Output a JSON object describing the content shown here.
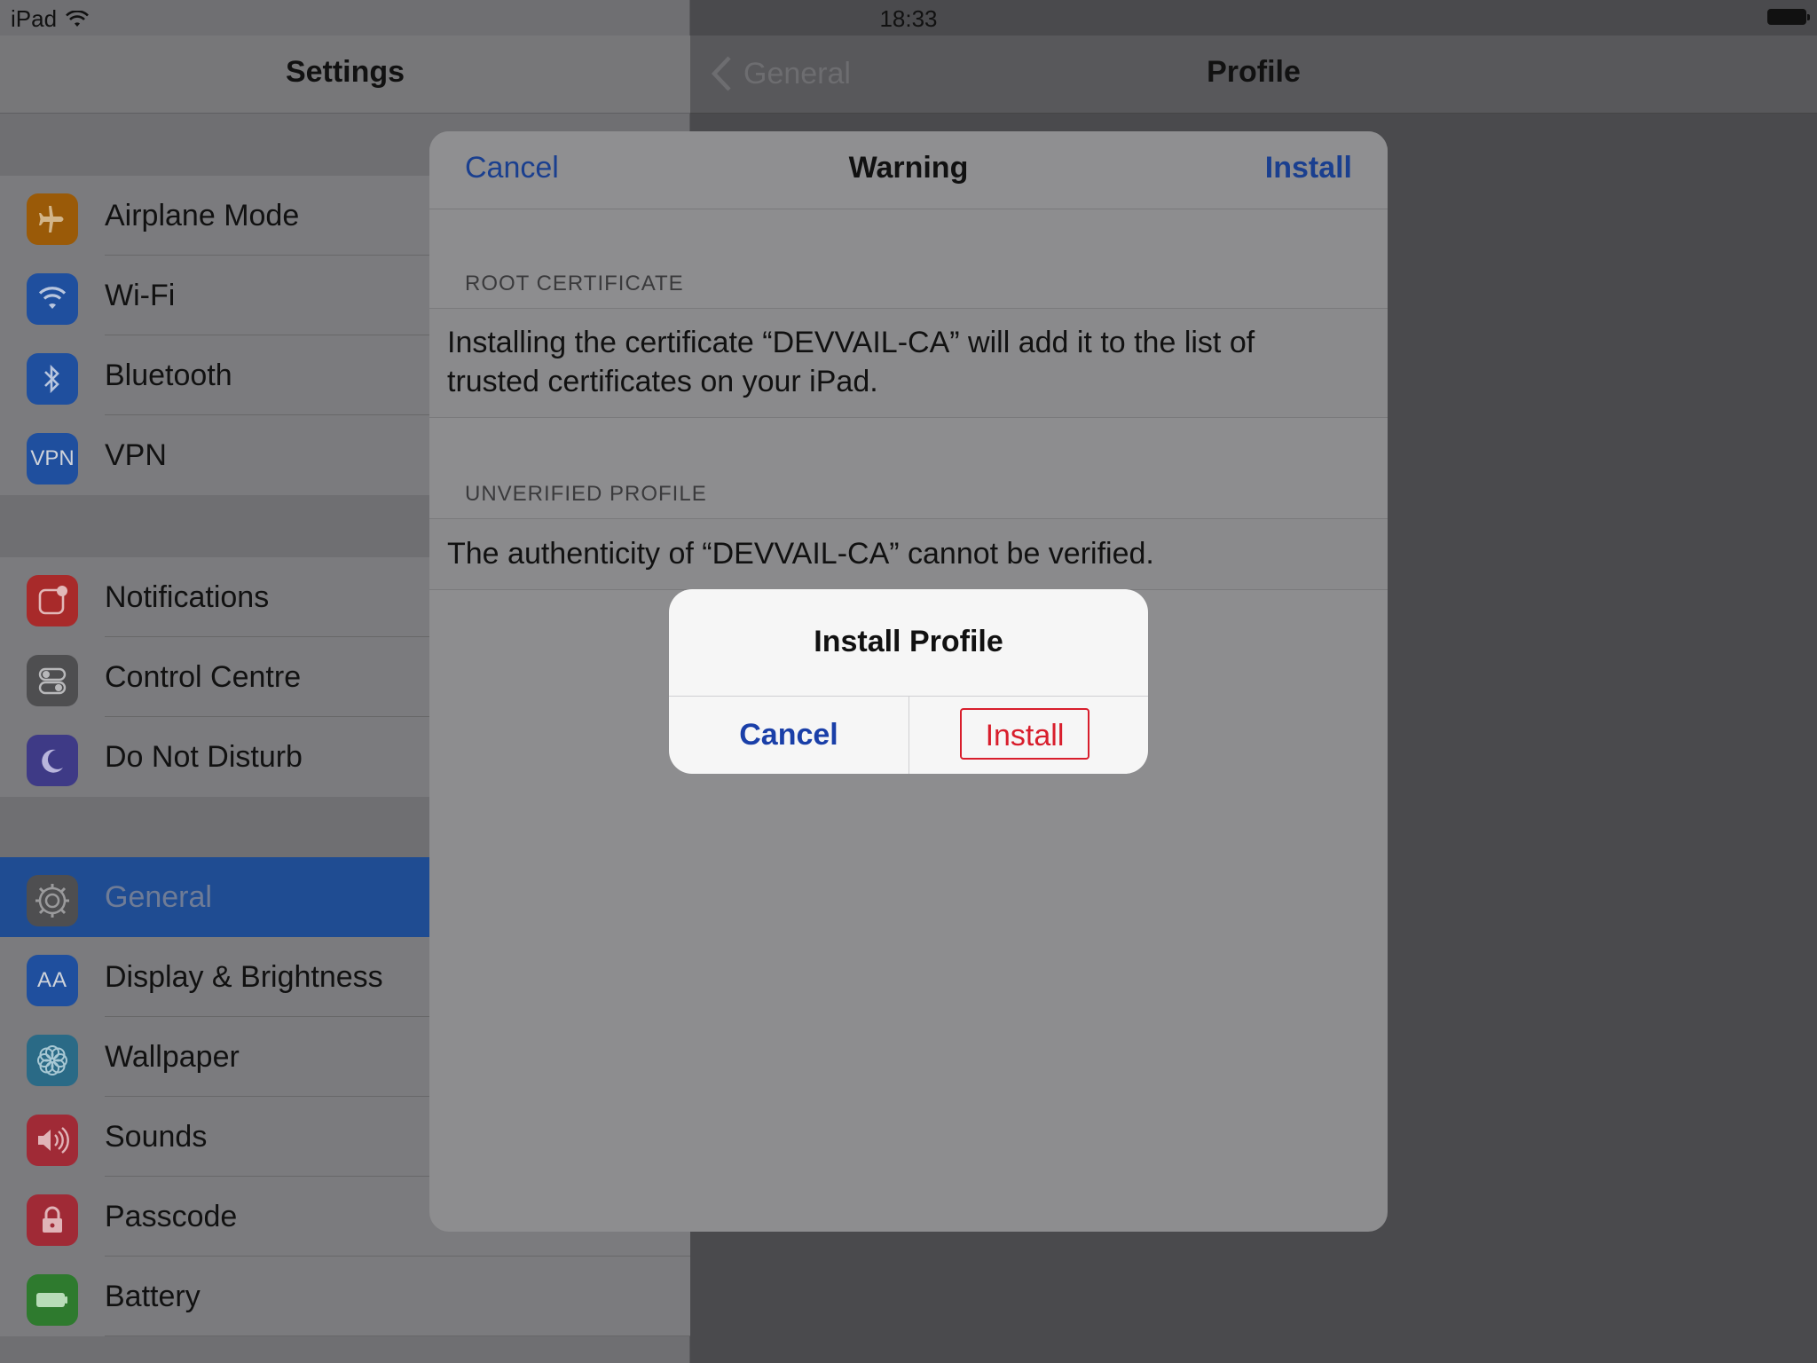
{
  "status_bar": {
    "device": "iPad",
    "time": "18:33"
  },
  "master": {
    "title": "Settings",
    "groups": [
      {
        "items": [
          {
            "label": "Airplane Mode",
            "icon": "airplane-icon",
            "color": "#9a5a08"
          },
          {
            "label": "Wi-Fi",
            "icon": "wifi-icon",
            "color": "#1f4f9e"
          },
          {
            "label": "Bluetooth",
            "icon": "bluetooth-icon",
            "color": "#1f4f9e"
          },
          {
            "label": "VPN",
            "icon": "vpn-icon",
            "color": "#1f4f9e",
            "icon_text": "VPN"
          }
        ]
      },
      {
        "items": [
          {
            "label": "Notifications",
            "icon": "notifications-icon",
            "color": "#a82a2a"
          },
          {
            "label": "Control Centre",
            "icon": "control-centre-icon",
            "color": "#4e4e50"
          },
          {
            "label": "Do Not Disturb",
            "icon": "moon-icon",
            "color": "#3e3a86"
          }
        ]
      },
      {
        "items": [
          {
            "label": "General",
            "icon": "gear-icon",
            "color": "#4e4e50",
            "selected": true
          },
          {
            "label": "Display & Brightness",
            "icon": "display-brightness-icon",
            "color": "#1f4f9e",
            "icon_text": "AA"
          },
          {
            "label": "Wallpaper",
            "icon": "wallpaper-icon",
            "color": "#2a6a86"
          },
          {
            "label": "Sounds",
            "icon": "sound-icon",
            "color": "#a02a36"
          },
          {
            "label": "Passcode",
            "icon": "lock-icon",
            "color": "#a02a36"
          },
          {
            "label": "Battery",
            "icon": "battery-icon",
            "color": "#2e7a2e"
          }
        ]
      }
    ]
  },
  "detail": {
    "back_label": "General",
    "title": "Profile"
  },
  "sheet": {
    "cancel_label": "Cancel",
    "title": "Warning",
    "install_label": "Install",
    "root_header": "ROOT CERTIFICATE",
    "root_text": "Installing the certificate “DEVVAIL-CA” will add it to the list of trusted certificates on your iPad.",
    "unverified_header": "UNVERIFIED PROFILE",
    "unverified_text": "The authenticity of “DEVVAIL-CA” cannot be verified."
  },
  "alert": {
    "title": "Install Profile",
    "cancel_label": "Cancel",
    "install_label": "Install"
  }
}
